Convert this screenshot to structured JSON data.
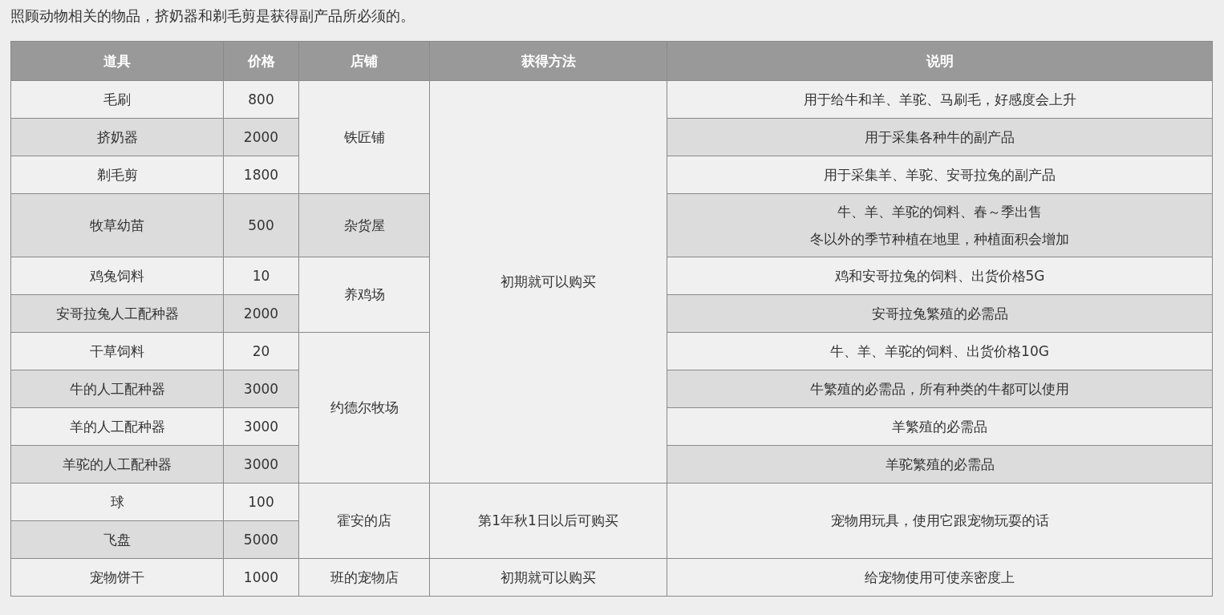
{
  "intro": "照顾动物相关的物品，挤奶器和剃毛剪是获得副产品所必须的。",
  "table": {
    "columns": [
      "道具",
      "价格",
      "店铺",
      "获得方法",
      "说明"
    ],
    "rows": [
      {
        "item": "毛刷",
        "price": "800",
        "shop": "铁匠铺",
        "method": "初期就可以购买",
        "description": [
          "用于给牛和羊、羊驼、马刷毛，好感度会上升"
        ]
      },
      {
        "item": "挤奶器",
        "price": "2000",
        "description": [
          "用于采集各种牛的副产品"
        ]
      },
      {
        "item": "剃毛剪",
        "price": "1800",
        "description": [
          "用于采集羊、羊驼、安哥拉兔的副产品"
        ]
      },
      {
        "item": "牧草幼苗",
        "price": "500",
        "shop": "杂货屋",
        "description": [
          "牛、羊、羊驼的饲料、春～季出售",
          "冬以外的季节种植在地里，种植面积会增加"
        ]
      },
      {
        "item": "鸡兔饲料",
        "price": "10",
        "shop": "养鸡场",
        "description": [
          "鸡和安哥拉兔的饲料、出货价格5G"
        ]
      },
      {
        "item": "安哥拉兔人工配种器",
        "price": "2000",
        "description": [
          "安哥拉兔繁殖的必需品"
        ]
      },
      {
        "item": "干草饲料",
        "price": "20",
        "shop": "约德尔牧场",
        "description": [
          "牛、羊、羊驼的饲料、出货价格10G"
        ]
      },
      {
        "item": "牛的人工配种器",
        "price": "3000",
        "description": [
          "牛繁殖的必需品，所有种类的牛都可以使用"
        ]
      },
      {
        "item": "羊的人工配种器",
        "price": "3000",
        "description": [
          "羊繁殖的必需品"
        ]
      },
      {
        "item": "羊驼的人工配种器",
        "price": "3000",
        "description": [
          "羊驼繁殖的必需品"
        ]
      },
      {
        "item": "球",
        "price": "100",
        "shop": "霍安的店",
        "method": "第1年秋1日以后可购买",
        "description": [
          "宠物用玩具，使用它跟宠物玩耍的话"
        ]
      },
      {
        "item": "飞盘",
        "price": "5000"
      },
      {
        "item": "宠物饼干",
        "price": "1000",
        "shop": "班的宠物店",
        "method": "初期就可以购买",
        "description": [
          "给宠物使用可使亲密度上"
        ]
      }
    ]
  }
}
